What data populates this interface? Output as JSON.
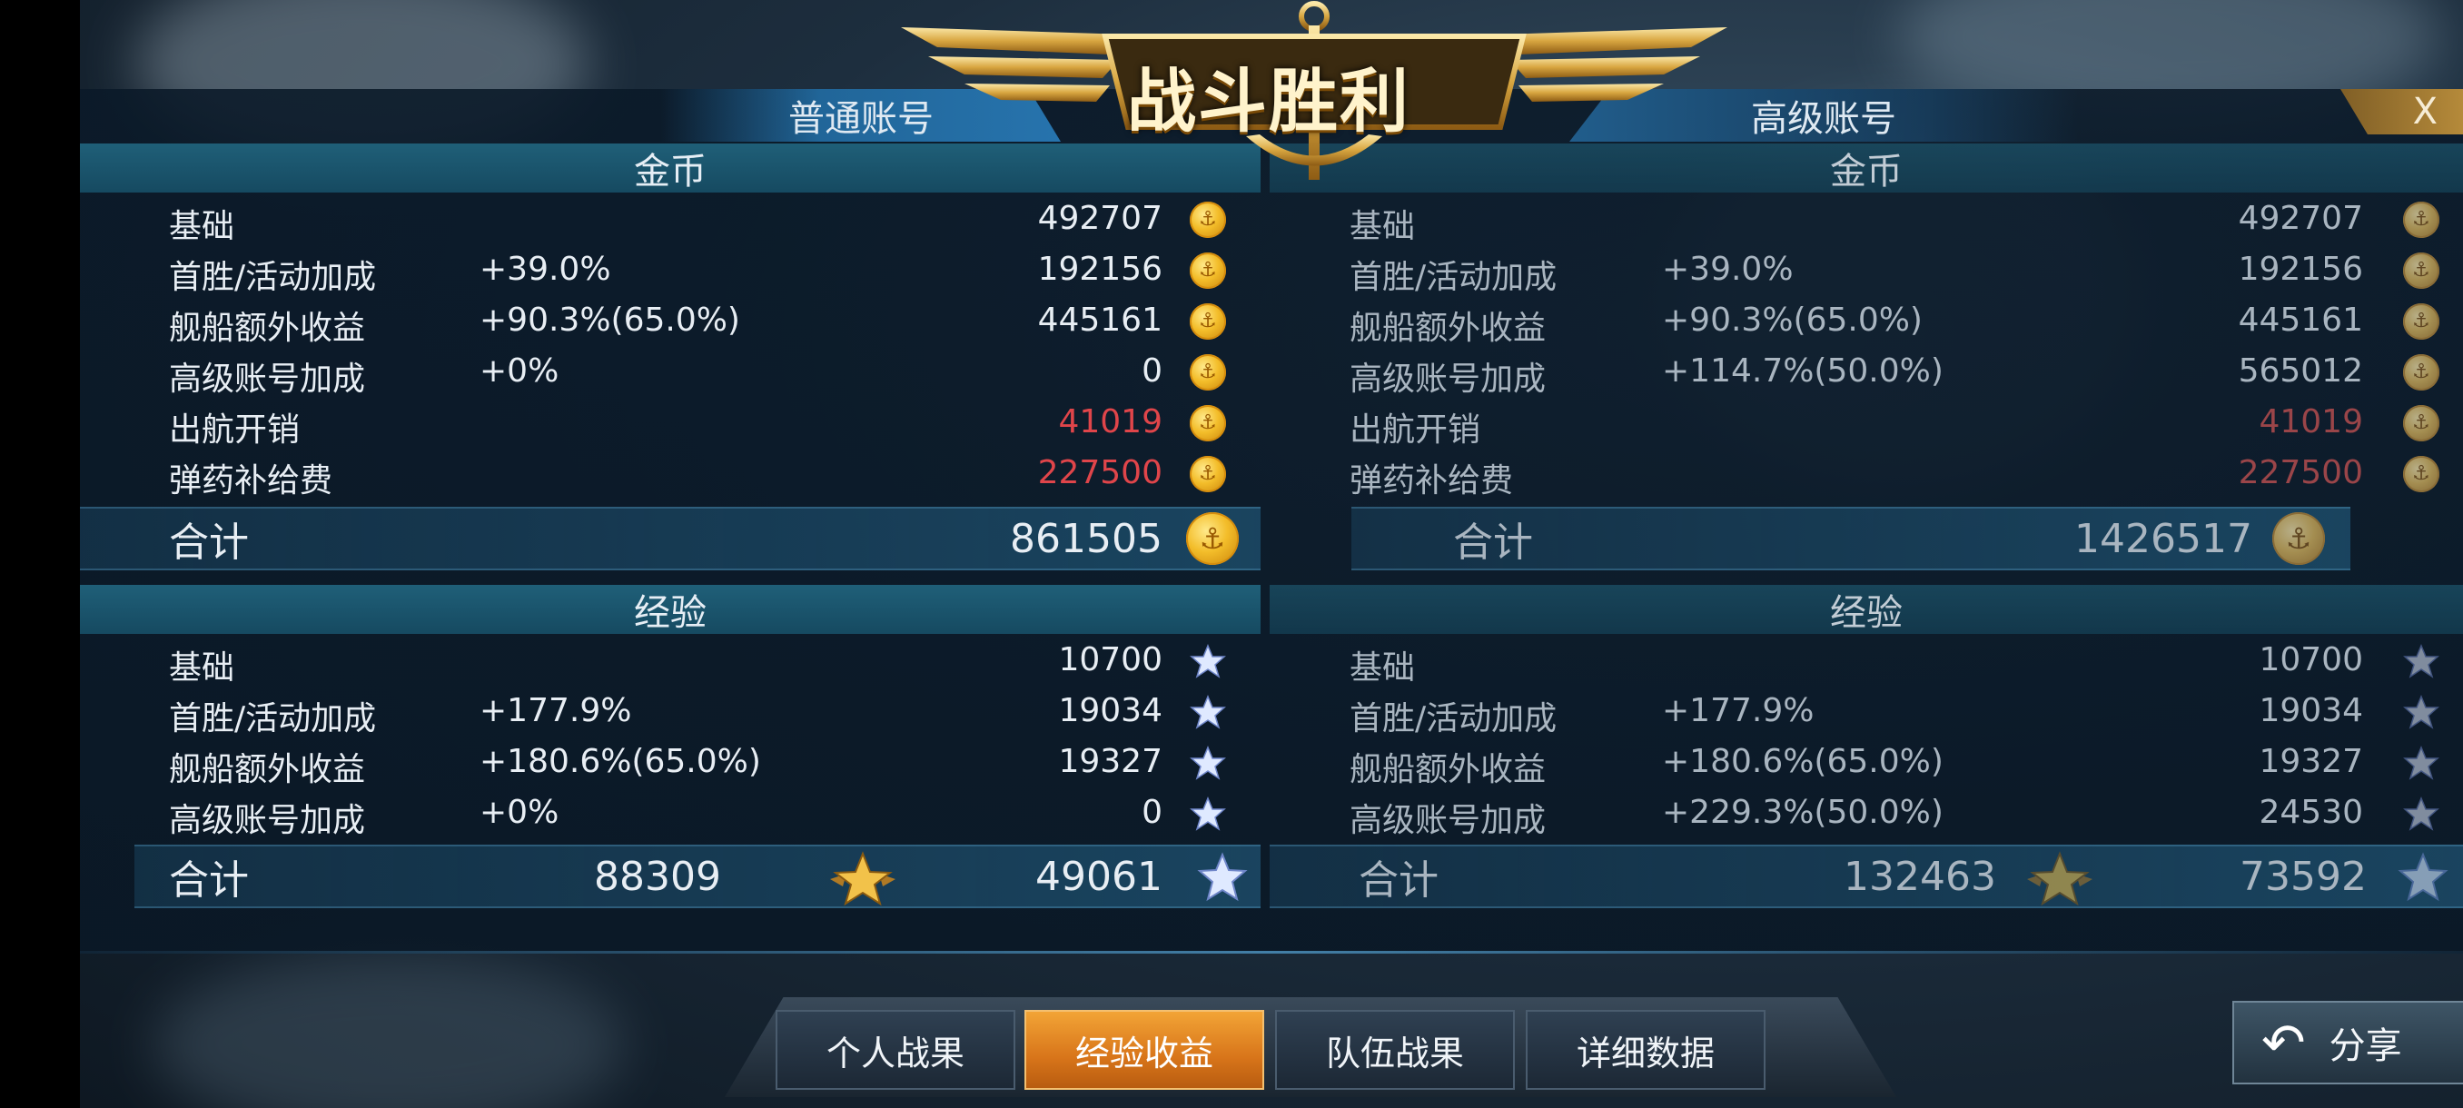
{
  "title": "战斗胜利",
  "close_label": "X",
  "tabs": {
    "normal": "普通账号",
    "premium": "高级账号"
  },
  "sections": {
    "gold": "金币",
    "exp": "经验"
  },
  "normal": {
    "gold_rows": [
      {
        "label": "基础",
        "pct": "",
        "value": "492707",
        "red": false
      },
      {
        "label": "首胜/活动加成",
        "pct": "+39.0%",
        "value": "192156",
        "red": false
      },
      {
        "label": "舰船额外收益",
        "pct": "+90.3%(65.0%)",
        "value": "445161",
        "red": false
      },
      {
        "label": "高级账号加成",
        "pct": "+0%",
        "value": "0",
        "red": false
      },
      {
        "label": "出航开销",
        "pct": "",
        "value": "41019",
        "red": true
      },
      {
        "label": "弹药补给费",
        "pct": "",
        "value": "227500",
        "red": true
      }
    ],
    "gold_total_label": "合计",
    "gold_total": "861505",
    "exp_rows": [
      {
        "label": "基础",
        "pct": "",
        "value": "10700"
      },
      {
        "label": "首胜/活动加成",
        "pct": "+177.9%",
        "value": "19034"
      },
      {
        "label": "舰船额外收益",
        "pct": "+180.6%(65.0%)",
        "value": "19327"
      },
      {
        "label": "高级账号加成",
        "pct": "+0%",
        "value": "0"
      }
    ],
    "exp_total_label": "合计",
    "exp_total_captain": "88309",
    "exp_total_ship": "49061"
  },
  "premium": {
    "gold_rows": [
      {
        "label": "基础",
        "pct": "",
        "value": "492707",
        "red": false
      },
      {
        "label": "首胜/活动加成",
        "pct": "+39.0%",
        "value": "192156",
        "red": false
      },
      {
        "label": "舰船额外收益",
        "pct": "+90.3%(65.0%)",
        "value": "445161",
        "red": false
      },
      {
        "label": "高级账号加成",
        "pct": "+114.7%(50.0%)",
        "value": "565012",
        "red": false
      },
      {
        "label": "出航开销",
        "pct": "",
        "value": "41019",
        "red": true
      },
      {
        "label": "弹药补给费",
        "pct": "",
        "value": "227500",
        "red": true
      }
    ],
    "gold_total_label": "合计",
    "gold_total": "1426517",
    "exp_rows": [
      {
        "label": "基础",
        "pct": "",
        "value": "10700"
      },
      {
        "label": "首胜/活动加成",
        "pct": "+177.9%",
        "value": "19034"
      },
      {
        "label": "舰船额外收益",
        "pct": "+180.6%(65.0%)",
        "value": "19327"
      },
      {
        "label": "高级账号加成",
        "pct": "+229.3%(50.0%)",
        "value": "24530"
      }
    ],
    "exp_total_label": "合计",
    "exp_total_captain": "132463",
    "exp_total_ship": "73592"
  },
  "bottom_tabs": [
    "个人战果",
    "经验收益",
    "队伍战果",
    "详细数据"
  ],
  "active_tab": "经验收益",
  "share_label": "分享",
  "icons": {
    "coin": "gold-coin-icon",
    "star": "ship-exp-star-icon",
    "captain_star": "captain-exp-star-icon",
    "close": "close-icon",
    "share": "share-arrow-icon",
    "emblem": "victory-emblem"
  },
  "colors": {
    "negative": "#e0454a",
    "active_tab": "#e88a25",
    "section_bar": "#1f5f78"
  }
}
